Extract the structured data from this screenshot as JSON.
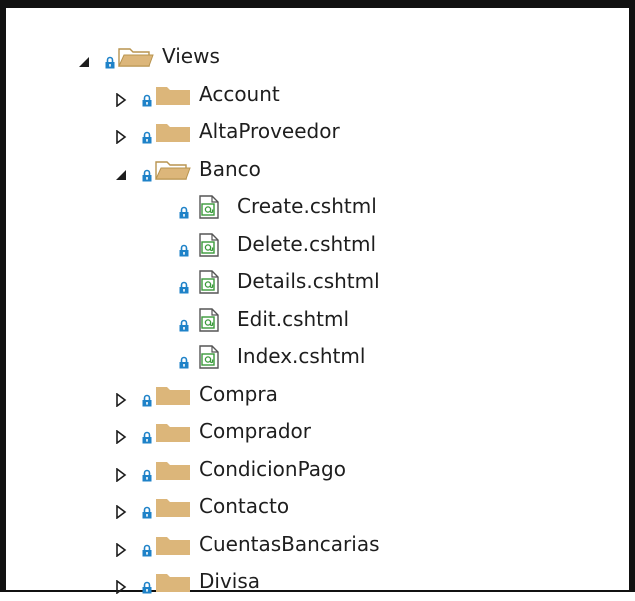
{
  "colors": {
    "folder": "#dcb67a",
    "lock": "#1e82c8",
    "file_accent": "#3a9a3a",
    "text": "#1e1e1e",
    "expander": "#1e1e1e"
  },
  "tree": [
    {
      "label": "Views",
      "level": 0,
      "kind": "folder",
      "state": "expanded"
    },
    {
      "label": "Account",
      "level": 1,
      "kind": "folder",
      "state": "collapsed"
    },
    {
      "label": "AltaProveedor",
      "level": 1,
      "kind": "folder",
      "state": "collapsed"
    },
    {
      "label": "Banco",
      "level": 1,
      "kind": "folder",
      "state": "expanded"
    },
    {
      "label": "Create.cshtml",
      "level": 2,
      "kind": "file"
    },
    {
      "label": "Delete.cshtml",
      "level": 2,
      "kind": "file"
    },
    {
      "label": "Details.cshtml",
      "level": 2,
      "kind": "file"
    },
    {
      "label": "Edit.cshtml",
      "level": 2,
      "kind": "file"
    },
    {
      "label": "Index.cshtml",
      "level": 2,
      "kind": "file"
    },
    {
      "label": "Compra",
      "level": 1,
      "kind": "folder",
      "state": "collapsed"
    },
    {
      "label": "Comprador",
      "level": 1,
      "kind": "folder",
      "state": "collapsed"
    },
    {
      "label": "CondicionPago",
      "level": 1,
      "kind": "folder",
      "state": "collapsed"
    },
    {
      "label": "Contacto",
      "level": 1,
      "kind": "folder",
      "state": "collapsed"
    },
    {
      "label": "CuentasBancarias",
      "level": 1,
      "kind": "folder",
      "state": "collapsed"
    },
    {
      "label": "Divisa",
      "level": 1,
      "kind": "folder",
      "state": "collapsed"
    }
  ]
}
